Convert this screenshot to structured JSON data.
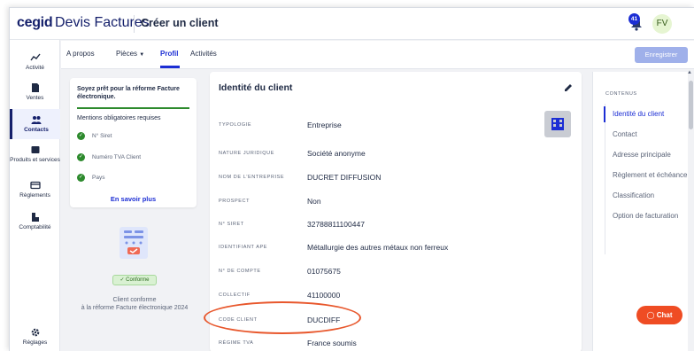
{
  "colors": {
    "brand": "#15206b",
    "accent": "#1c2ed4",
    "success": "#2d8a2d",
    "highlight": "#e8572c",
    "chat": "#ef4c23"
  },
  "header": {
    "brand": "cegid",
    "app": "Devis Factures",
    "page_title": "Créer un client",
    "notification_count": "41",
    "avatar_initials": "FV"
  },
  "sidebar": {
    "items": [
      {
        "label": "Activité",
        "icon": "chart-icon"
      },
      {
        "label": "Ventes",
        "icon": "document-icon"
      },
      {
        "label": "Contacts",
        "icon": "users-icon"
      },
      {
        "label": "Produits et services",
        "icon": "box-icon"
      },
      {
        "label": "Règlements",
        "icon": "card-icon"
      },
      {
        "label": "Comptabilité",
        "icon": "ledger-icon"
      },
      {
        "label": "Réglages",
        "icon": "gear-icon"
      }
    ]
  },
  "tabs": {
    "apropos": "A propos",
    "pieces": "Pièces",
    "profil": "Profil",
    "activites": "Activités",
    "save": "Enregistrer"
  },
  "compliance": {
    "title": "Soyez prêt pour la réforme Facture électronique.",
    "subtitle": "Mentions obligatoires requises",
    "items": [
      "N° Siret",
      "Numéro TVA Client",
      "Pays"
    ],
    "link": "En savoir plus",
    "badge": "Conforme",
    "status_line1": "Client conforme",
    "status_line2": "à la réforme Facture électronique 2024"
  },
  "identity": {
    "title": "Identité du client",
    "fields": [
      {
        "label": "Typologie",
        "value": "Entreprise"
      },
      {
        "label": "Nature juridique",
        "value": "Société anonyme"
      },
      {
        "label": "Nom de l'entreprise",
        "value": "DUCRET DIFFUSION"
      },
      {
        "label": "Prospect",
        "value": "Non"
      },
      {
        "label": "N° Siret",
        "value": "32788811100447"
      },
      {
        "label": "Identifiant APE",
        "value": "Métallurgie des autres métaux non ferreux"
      },
      {
        "label": "N° de compte",
        "value": "01075675"
      },
      {
        "label": "Collectif",
        "value": "41100000"
      },
      {
        "label": "Code client",
        "value": "DUCDIFF"
      },
      {
        "label": "Régime TVA",
        "value": "France soumis"
      }
    ]
  },
  "toc": {
    "heading": "CONTENUS",
    "items": [
      "Identité du client",
      "Contact",
      "Adresse principale",
      "Règlement et échéance",
      "Classification",
      "Option de facturation"
    ]
  },
  "chat": {
    "label": "Chat"
  }
}
